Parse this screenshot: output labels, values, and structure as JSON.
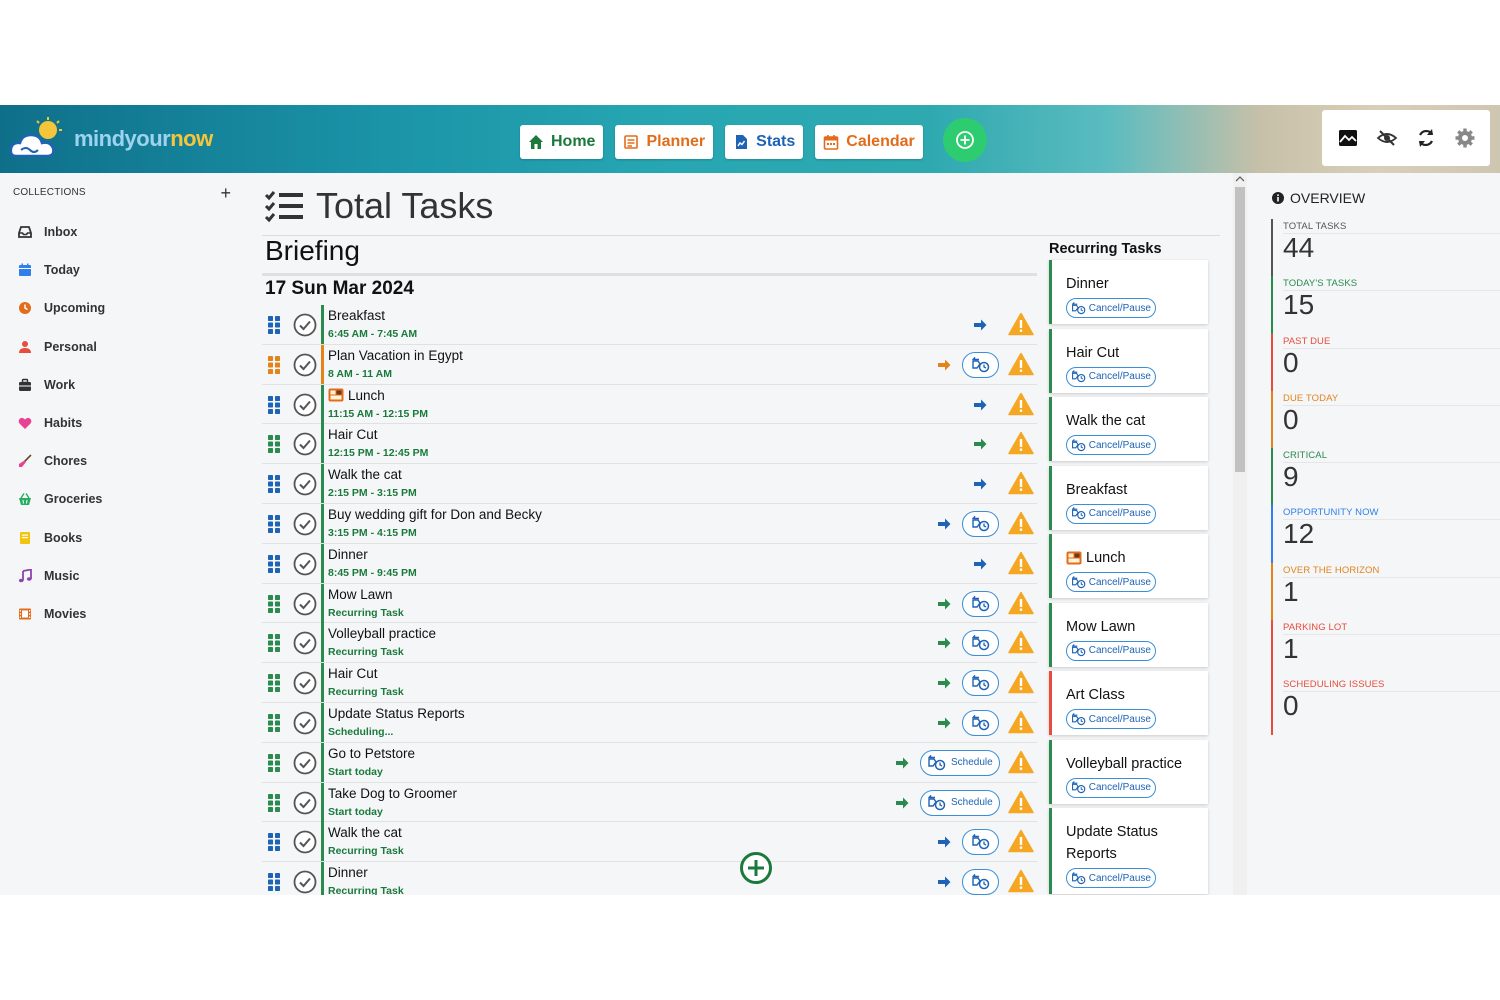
{
  "brand": {
    "name_part1": "mindyour",
    "name_part2": "now"
  },
  "nav": [
    {
      "id": "home",
      "label": "Home"
    },
    {
      "id": "planner",
      "label": "Planner"
    },
    {
      "id": "stats",
      "label": "Stats"
    },
    {
      "id": "calendar",
      "label": "Calendar"
    }
  ],
  "toolbar_icons": [
    "landscape-icon",
    "hide-icon",
    "sync-icon",
    "settings-icon"
  ],
  "sidebar": {
    "collections_label": "COLLECTIONS",
    "add_symbol": "+",
    "items": [
      {
        "label": "Inbox",
        "icon": "inbox-icon",
        "color": "#333333"
      },
      {
        "label": "Today",
        "icon": "calendar-icon",
        "color": "#2f80ed"
      },
      {
        "label": "Upcoming",
        "icon": "clock-icon",
        "color": "#e36c1a"
      },
      {
        "label": "Personal",
        "icon": "person-icon",
        "color": "#e74c3c"
      },
      {
        "label": "Work",
        "icon": "briefcase-icon",
        "color": "#333333"
      },
      {
        "label": "Habits",
        "icon": "heart-icon",
        "color": "#e84393"
      },
      {
        "label": "Chores",
        "icon": "broom-icon",
        "color": "#e84393"
      },
      {
        "label": "Groceries",
        "icon": "basket-icon",
        "color": "#27ae60"
      },
      {
        "label": "Books",
        "icon": "book-icon",
        "color": "#f1c40f"
      },
      {
        "label": "Music",
        "icon": "music-icon",
        "color": "#8e44ad"
      },
      {
        "label": "Movies",
        "icon": "film-icon",
        "color": "#e36c1a"
      }
    ]
  },
  "main": {
    "title": "Total Tasks",
    "briefing": "Briefing",
    "date_heading": "17 Sun Mar 2024",
    "tasks": [
      {
        "name": "Breakfast",
        "sub": "6:45 AM - 7:45 AM",
        "drag_color": "#1e63b5",
        "bar_color": "#2b8a4e",
        "arrow_color": "#1e63b5",
        "schedule_button": "none"
      },
      {
        "name": "Plan Vacation in Egypt",
        "sub": "8 AM - 11 AM",
        "drag_color": "#e3831a",
        "bar_color": "#e3831a",
        "arrow_color": "#e3831a",
        "schedule_button": "icon"
      },
      {
        "name": "Lunch",
        "sub": "11:15 AM - 12:15 PM",
        "drag_color": "#1e63b5",
        "bar_color": "#2b8a4e",
        "arrow_color": "#1e63b5",
        "schedule_button": "none",
        "has_icon": true
      },
      {
        "name": "Hair Cut",
        "sub": "12:15 PM - 12:45 PM",
        "drag_color": "#2b8a4e",
        "bar_color": "#2b8a4e",
        "arrow_color": "#2b8a4e",
        "schedule_button": "none"
      },
      {
        "name": "Walk the cat",
        "sub": "2:15 PM - 3:15 PM",
        "drag_color": "#1e63b5",
        "bar_color": "#2b8a4e",
        "arrow_color": "#1e63b5",
        "schedule_button": "none"
      },
      {
        "name": "Buy wedding gift for Don and Becky",
        "sub": "3:15 PM - 4:15 PM",
        "drag_color": "#1e63b5",
        "bar_color": "#2b8a4e",
        "arrow_color": "#1e63b5",
        "schedule_button": "icon"
      },
      {
        "name": "Dinner",
        "sub": "8:45 PM - 9:45 PM",
        "drag_color": "#1e63b5",
        "bar_color": "#2b8a4e",
        "arrow_color": "#1e63b5",
        "schedule_button": "none"
      },
      {
        "name": "Mow Lawn",
        "sub": "Recurring Task",
        "drag_color": "#2b8a4e",
        "bar_color": "#2b8a4e",
        "arrow_color": "#2b8a4e",
        "schedule_button": "icon"
      },
      {
        "name": "Volleyball practice",
        "sub": "Recurring Task",
        "drag_color": "#2b8a4e",
        "bar_color": "#2b8a4e",
        "arrow_color": "#2b8a4e",
        "schedule_button": "icon"
      },
      {
        "name": "Hair Cut",
        "sub": "Recurring Task",
        "drag_color": "#2b8a4e",
        "bar_color": "#2b8a4e",
        "arrow_color": "#2b8a4e",
        "schedule_button": "icon"
      },
      {
        "name": "Update Status Reports",
        "sub": "Scheduling...",
        "drag_color": "#2b8a4e",
        "bar_color": "#2b8a4e",
        "arrow_color": "#2b8a4e",
        "schedule_button": "icon"
      },
      {
        "name": "Go to Petstore",
        "sub": "Start today",
        "drag_color": "#2b8a4e",
        "bar_color": "#2b8a4e",
        "arrow_color": "#2b8a4e",
        "schedule_button": "label"
      },
      {
        "name": "Take Dog to Groomer",
        "sub": "Start today",
        "drag_color": "#2b8a4e",
        "bar_color": "#2b8a4e",
        "arrow_color": "#2b8a4e",
        "schedule_button": "label"
      },
      {
        "name": "Walk the cat",
        "sub": "Recurring Task",
        "drag_color": "#1e63b5",
        "bar_color": "#2b8a4e",
        "arrow_color": "#1e63b5",
        "schedule_button": "icon"
      },
      {
        "name": "Dinner",
        "sub": "Recurring Task",
        "drag_color": "#1e63b5",
        "bar_color": "#2b8a4e",
        "arrow_color": "#1e63b5",
        "schedule_button": "icon"
      }
    ],
    "schedule_label": "Schedule"
  },
  "recurring": {
    "title": "Recurring Tasks",
    "button_label": "Cancel/Pause",
    "items": [
      {
        "name": "Dinner",
        "bar_color": "#2b8a4e"
      },
      {
        "name": "Hair Cut",
        "bar_color": "#2b8a4e"
      },
      {
        "name": "Walk the cat",
        "bar_color": "#2b8a4e"
      },
      {
        "name": "Breakfast",
        "bar_color": "#2b8a4e"
      },
      {
        "name": "Lunch",
        "bar_color": "#2b8a4e",
        "has_icon": true
      },
      {
        "name": "Mow Lawn",
        "bar_color": "#2b8a4e"
      },
      {
        "name": "Art Class",
        "bar_color": "#e74c3c"
      },
      {
        "name": "Volleyball practice",
        "bar_color": "#2b8a4e"
      },
      {
        "name": "Update Status Reports",
        "bar_color": "#2b8a4e"
      }
    ]
  },
  "overview": {
    "title": "OVERVIEW",
    "stats": [
      {
        "label": "TOTAL TASKS",
        "value": "44",
        "color": "#555555"
      },
      {
        "label": "TODAY'S TASKS",
        "value": "15",
        "color": "#2b8a4e"
      },
      {
        "label": "PAST DUE",
        "value": "0",
        "color": "#e74c3c"
      },
      {
        "label": "DUE TODAY",
        "value": "0",
        "color": "#e3831a"
      },
      {
        "label": "CRITICAL",
        "value": "9",
        "color": "#2b8a4e"
      },
      {
        "label": "OPPORTUNITY NOW",
        "value": "12",
        "color": "#2f80ed"
      },
      {
        "label": "OVER THE HORIZON",
        "value": "1",
        "color": "#e3831a"
      },
      {
        "label": "PARKING LOT",
        "value": "1",
        "color": "#e74c3c"
      },
      {
        "label": "SCHEDULING ISSUES",
        "value": "0",
        "color": "#e74c3c"
      }
    ]
  }
}
